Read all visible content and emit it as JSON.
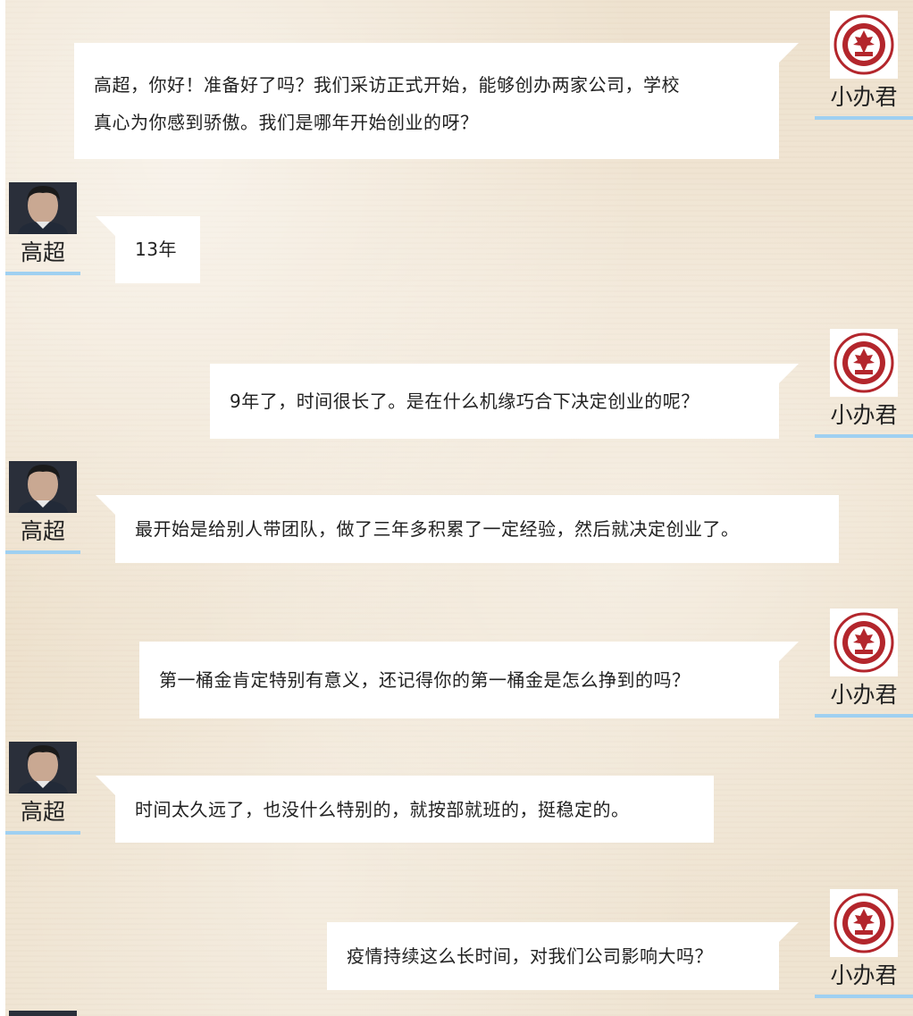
{
  "speakers": {
    "interviewer": {
      "name": "小办君",
      "avatar_icon": "school-seal-icon"
    },
    "interviewee": {
      "name": "高超",
      "avatar_icon": "person-photo-icon"
    }
  },
  "messages": [
    {
      "speaker": "interviewer",
      "lines": [
        "高超，你好！准备好了吗？我们采访正式开始，能够创办两家公司，学校",
        "真心为你感到骄傲。我们是哪年开始创业的呀？"
      ]
    },
    {
      "speaker": "interviewee",
      "lines": [
        "13年"
      ]
    },
    {
      "speaker": "interviewer",
      "lines": [
        "9年了，时间很长了。是在什么机缘巧合下决定创业的呢？"
      ]
    },
    {
      "speaker": "interviewee",
      "lines": [
        "最开始是给别人带团队，做了三年多积累了一定经验，然后就决定创业了。"
      ]
    },
    {
      "speaker": "interviewer",
      "lines": [
        "第一桶金肯定特别有意义，还记得你的第一桶金是怎么挣到的吗？"
      ]
    },
    {
      "speaker": "interviewee",
      "lines": [
        "时间太久远了，也没什么特别的，就按部就班的，挺稳定的。"
      ]
    },
    {
      "speaker": "interviewer",
      "lines": [
        "疫情持续这么长时间，对我们公司影响大吗？"
      ]
    }
  ],
  "colors": {
    "name_underline": "#9fd0f1",
    "bubble": "#ffffff",
    "seal_red": "#b3262c"
  }
}
